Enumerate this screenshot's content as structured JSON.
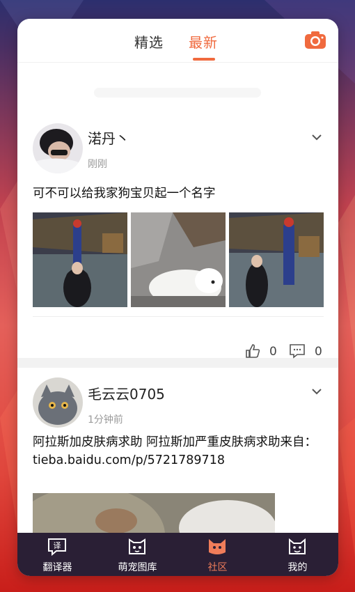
{
  "header": {
    "tabs": [
      {
        "label": "精选",
        "active": false
      },
      {
        "label": "最新",
        "active": true
      }
    ],
    "camera_icon": "camera-icon",
    "accent_color": "#f06a3e"
  },
  "posts": [
    {
      "username": "渃丹丶",
      "time": "刚刚",
      "text": "可不可以给我家狗宝贝起一个名字",
      "images": [
        "photo-woman-robot",
        "photo-white-dog",
        "photo-woman-robot-2"
      ],
      "likes": "0",
      "comments": "0"
    },
    {
      "username": "毛云云0705",
      "time": "1分钟前",
      "text": "阿拉斯加皮肤病求助 阿拉斯加严重皮肤病求助来自：tieba.baidu.com/p/5721789718",
      "images": [
        "photo-dog-skin"
      ]
    }
  ],
  "nav": {
    "items": [
      {
        "label": "翻译器",
        "icon": "translator-icon",
        "active": false
      },
      {
        "label": "萌宠图库",
        "icon": "pet-gallery-icon",
        "active": false
      },
      {
        "label": "社区",
        "icon": "community-cat-icon",
        "active": true
      },
      {
        "label": "我的",
        "icon": "profile-cat-icon",
        "active": false
      }
    ],
    "background": "#2a1f35",
    "active_color": "#f07d5a"
  }
}
